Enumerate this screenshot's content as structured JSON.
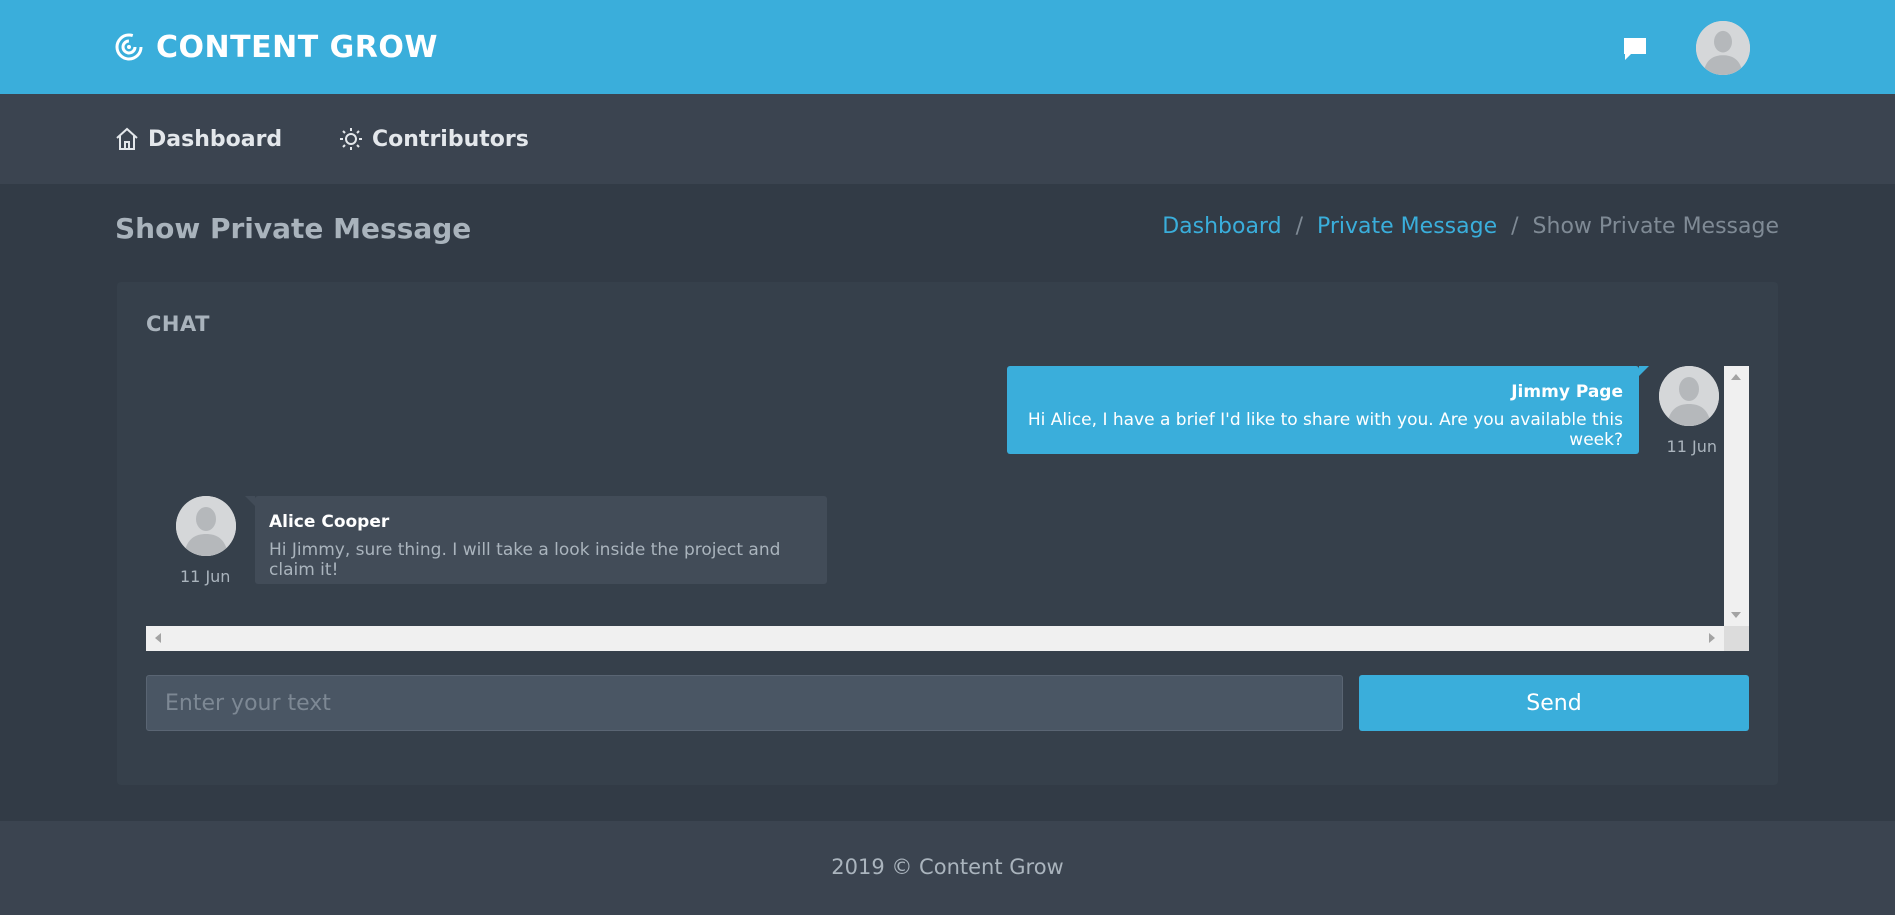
{
  "header": {
    "brand_name": "CONTENT GROW",
    "icons": {
      "logo": "spiral-logo-icon",
      "messages": "chat-bubble-icon",
      "avatar": "user-avatar-icon"
    }
  },
  "nav": {
    "items": [
      {
        "label": "Dashboard",
        "icon": "home-icon"
      },
      {
        "label": "Contributors",
        "icon": "sun-icon"
      }
    ]
  },
  "page": {
    "title": "Show Private Message",
    "breadcrumb": {
      "items": [
        "Dashboard",
        "Private Message",
        "Show Private Message"
      ],
      "separator": "/"
    }
  },
  "chat": {
    "title": "CHAT",
    "messages": [
      {
        "author": "Jimmy Page",
        "text": "Hi Alice, I have a brief I'd like to share with you. Are you available this week?",
        "time": "11 Jun",
        "side": "right"
      },
      {
        "author": "Alice Cooper",
        "text": "Hi Jimmy, sure thing. I will take a look inside the project and claim it!",
        "time": "11 Jun",
        "side": "left"
      }
    ],
    "input_placeholder": "Enter your text",
    "input_value": "",
    "send_label": "Send"
  },
  "footer": {
    "text": "2019 © Content Grow"
  },
  "colors": {
    "accent": "#3aaedb",
    "background": "#323b46",
    "navbar": "#3b4450",
    "card": "#36404b"
  }
}
